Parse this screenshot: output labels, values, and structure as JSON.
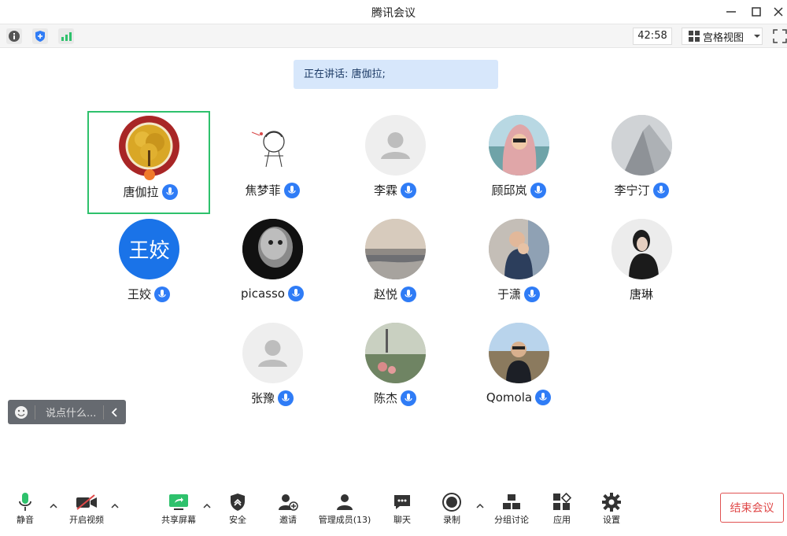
{
  "window": {
    "title": "腾讯会议"
  },
  "top": {
    "timer": "42:58",
    "view_mode": "宫格视图"
  },
  "speaking": {
    "label": "正在讲话: 唐伽拉;"
  },
  "participants": [
    {
      "name": "唐伽拉",
      "mic": true
    },
    {
      "name": "焦梦菲",
      "mic": true
    },
    {
      "name": "李霖",
      "mic": true
    },
    {
      "name": "顾邱岚",
      "mic": true
    },
    {
      "name": "李宁汀",
      "mic": true
    },
    {
      "name": "王姣",
      "mic": true,
      "initials": "王姣"
    },
    {
      "name": "picasso",
      "mic": true
    },
    {
      "name": "赵悦",
      "mic": true
    },
    {
      "name": "于潇",
      "mic": true
    },
    {
      "name": "唐琳",
      "mic": false
    },
    {
      "name": "张豫",
      "mic": true
    },
    {
      "name": "陈杰",
      "mic": true
    },
    {
      "name": "Qomola",
      "mic": true
    }
  ],
  "chat": {
    "placeholder": "说点什么..."
  },
  "bottom": {
    "mute": "静音",
    "video": "开启视频",
    "share": "共享屏幕",
    "security": "安全",
    "invite": "邀请",
    "members": "管理成员(13)",
    "chat": "聊天",
    "record": "录制",
    "breakout": "分组讨论",
    "apps": "应用",
    "settings": "设置",
    "end": "结束会议"
  },
  "colors": {
    "accent": "#2f7cf6",
    "active_border": "#2ec16c",
    "end_red": "#e04848",
    "speaking_bg": "#d7e7fb"
  }
}
